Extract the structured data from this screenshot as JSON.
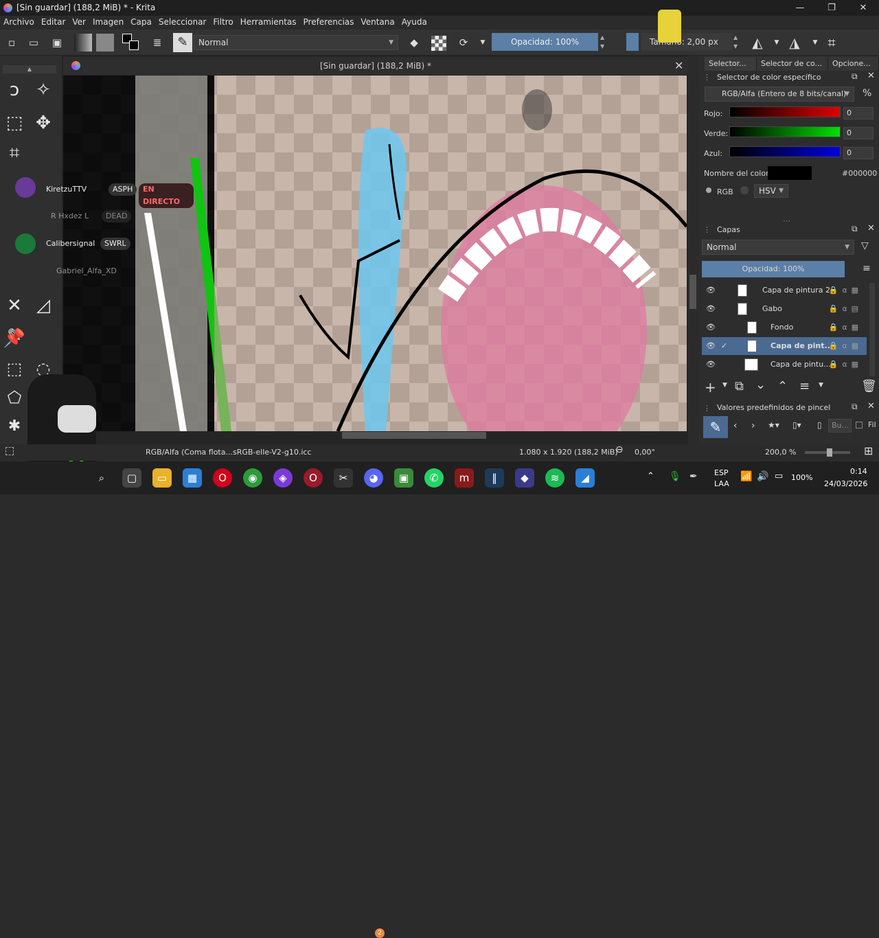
{
  "window": {
    "title": "[Sin guardar]  (188,2 MiB) * - Krita",
    "minimize": "—",
    "maximize": "❐",
    "close": "✕"
  },
  "menu": [
    "Archivo",
    "Editar",
    "Ver",
    "Imagen",
    "Capa",
    "Seleccionar",
    "Filtro",
    "Herramientas",
    "Preferencias",
    "Ventana",
    "Ayuda"
  ],
  "toolbar": {
    "blend_mode": "Normal",
    "opacity": "Opacidad: 100%",
    "size": "Tamaño: 2,00 px"
  },
  "canvas": {
    "title": "[Sin guardar]  (188,2 MiB) *",
    "close": "✕"
  },
  "stream_overlay": {
    "users": [
      {
        "name": "KiretzuTTV",
        "tag": "ASPH",
        "live": "EN DIRECTO"
      },
      {
        "name": "R Hxdez L",
        "tag": "DEAD"
      },
      {
        "name": "Calibersignal",
        "tag": "SWRL"
      },
      {
        "name": "Gabriel_Alfa_XD",
        "tag": ""
      }
    ]
  },
  "dock": {
    "tabs": [
      "Selector...",
      "Selector de co...",
      "Opcione..."
    ],
    "color_panel": {
      "title": "Selector de color específico",
      "model": "RGB/Alfa (Entero de 8 bits/canal)",
      "percent": "%",
      "channels": [
        {
          "label": "Rojo:",
          "value": "0",
          "color": "#e00000"
        },
        {
          "label": "Verde:",
          "value": "0",
          "color": "#00e000"
        },
        {
          "label": "Azul:",
          "value": "0",
          "color": "#0000e0"
        }
      ],
      "name_label": "Nombre del color:",
      "hex": "#000000",
      "rgb_label": "RGB",
      "hsv_label": "HSV"
    },
    "layers_panel": {
      "title": "Capas",
      "blend": "Normal",
      "opacity": "Opacidad:  100%",
      "layers": [
        {
          "name": "Capa de pintura 2",
          "selected": false,
          "indent": 0
        },
        {
          "name": "Gabo",
          "selected": false,
          "indent": 0
        },
        {
          "name": "Fondo",
          "selected": false,
          "indent": 1
        },
        {
          "name": "Capa de pint...",
          "selected": true,
          "indent": 1
        },
        {
          "name": "Capa de pintu...",
          "selected": false,
          "indent": 1
        }
      ]
    },
    "brush_panel": {
      "title": "Valores predefinidos de pincel",
      "search_placeholder": "Bu...",
      "filter": "Fil"
    }
  },
  "status": {
    "color_profile": "RGB/Alfa (Coma flota...sRGB-elle-V2-g10.icc",
    "dimensions": "1.080 x 1.920 (188,2 MiB)",
    "rotation": "0,00°",
    "zoom": "200,0 %",
    "zoom_level": 0.55
  },
  "taskbar": {
    "lang1": "ESP",
    "lang2": "LAA",
    "battery": "100%",
    "time": "0:14",
    "date": "24/03/2026",
    "discord_badge": "2"
  }
}
